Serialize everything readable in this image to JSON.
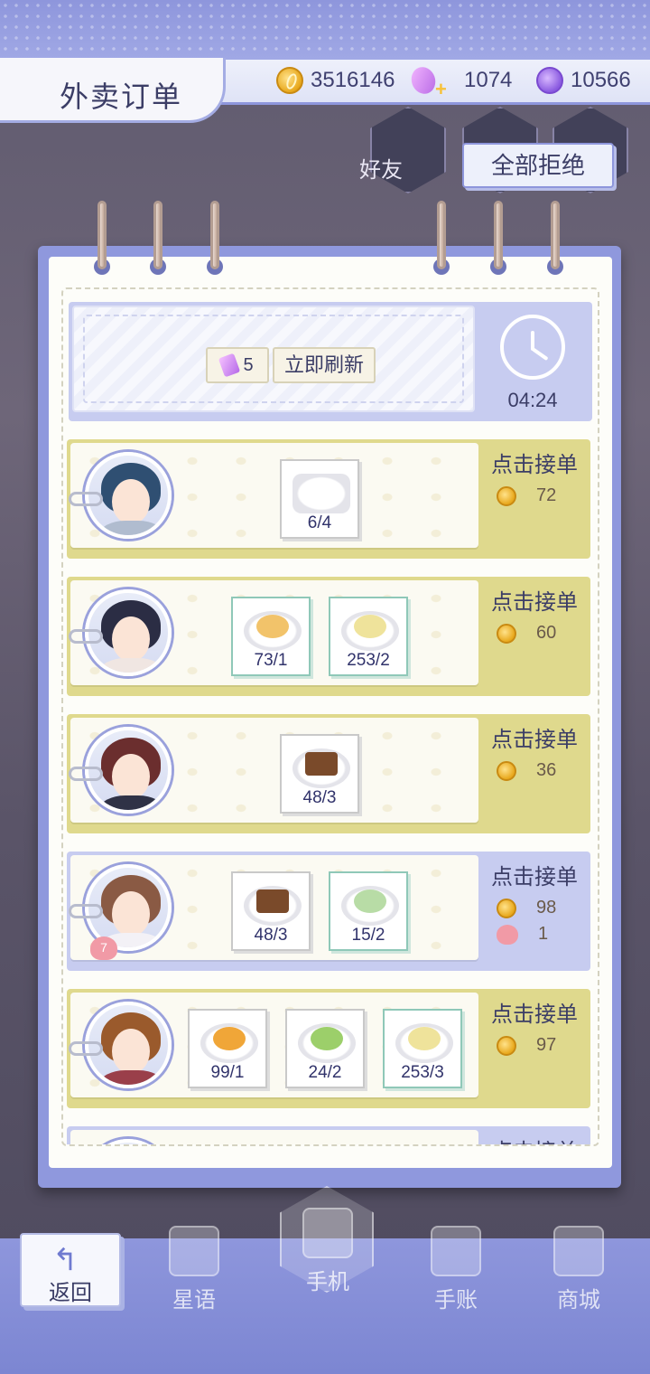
{
  "header": {
    "title": "外卖订单",
    "gold": "3516146",
    "gems": "1074",
    "moons": "10566"
  },
  "background": {
    "friends_label": "好友"
  },
  "reject_all_label": "全部拒绝",
  "refresh": {
    "cost": "5",
    "button_label": "立即刷新",
    "timer": "04:24"
  },
  "orders": [
    {
      "accept_label": "点击接单",
      "items": [
        {
          "name": "milk-cup",
          "count": "6/4"
        }
      ],
      "rewards": {
        "gold": "72"
      }
    },
    {
      "accept_label": "点击接单",
      "items": [
        {
          "name": "pancake",
          "count": "73/1"
        },
        {
          "name": "soup",
          "count": "253/2"
        }
      ],
      "rewards": {
        "gold": "60"
      }
    },
    {
      "accept_label": "点击接单",
      "items": [
        {
          "name": "cake-slice",
          "count": "48/3"
        }
      ],
      "rewards": {
        "gold": "36"
      }
    },
    {
      "accept_label": "点击接单",
      "badge": "7",
      "items": [
        {
          "name": "cake-slice",
          "count": "48/3"
        },
        {
          "name": "salad",
          "count": "15/2"
        }
      ],
      "rewards": {
        "gold": "98",
        "hearts": "1"
      }
    },
    {
      "accept_label": "点击接单",
      "items": [
        {
          "name": "orange-pastry",
          "count": "99/1"
        },
        {
          "name": "green-tea",
          "count": "24/2"
        },
        {
          "name": "soup",
          "count": "253/3"
        }
      ],
      "rewards": {
        "gold": "97"
      }
    },
    {
      "accept_label": "点击接单"
    }
  ],
  "bottom_nav": {
    "back": "返回",
    "stars": "星语",
    "phone": "手机",
    "journal": "手账",
    "shop": "商城"
  },
  "colors": {
    "accent": "#8e96dc",
    "order_yellow": "#dfd98d",
    "order_blue": "#c7ccf0"
  }
}
